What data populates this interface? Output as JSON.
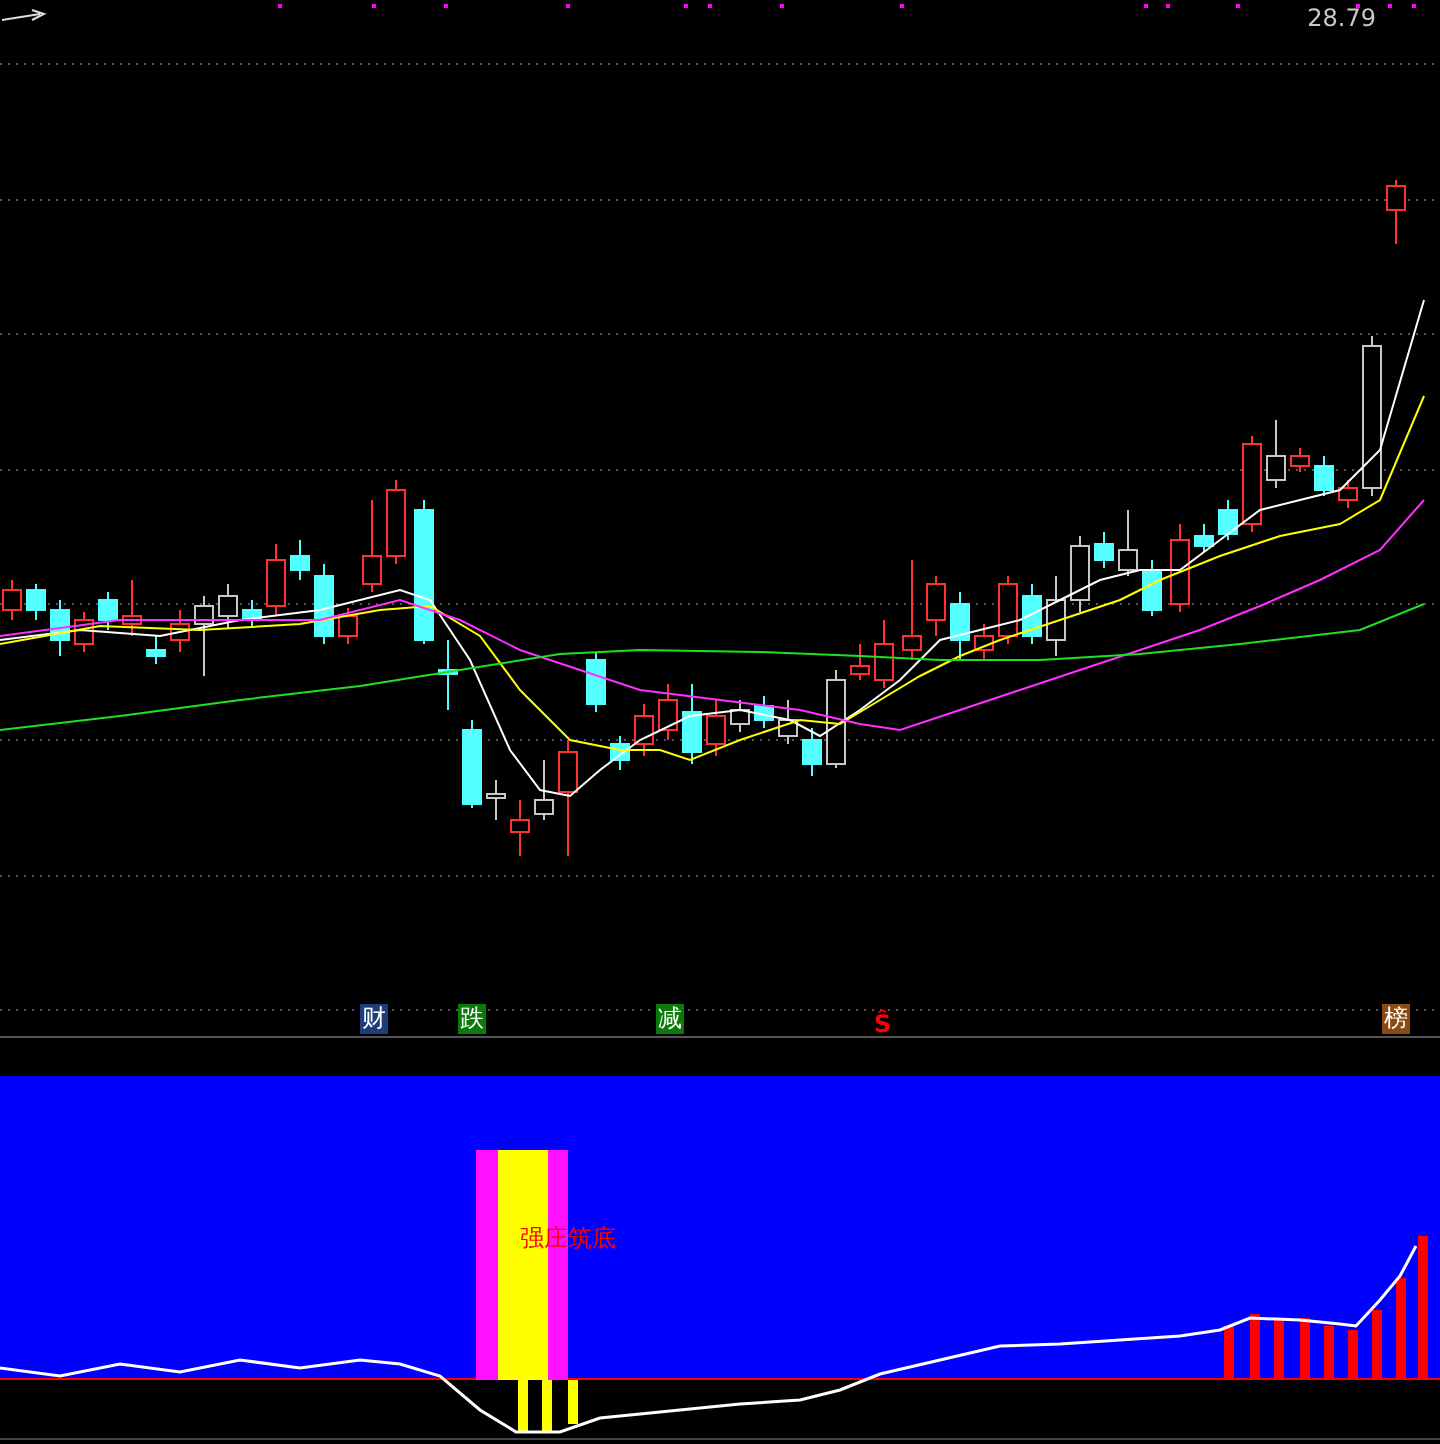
{
  "price_chart": {
    "last_price_label": "28.79",
    "event_markers": [
      {
        "label": "财",
        "kind": "badge",
        "color": "#1c3f7c"
      },
      {
        "label": "跌",
        "kind": "badge",
        "color": "#0b7a0b"
      },
      {
        "label": "减",
        "kind": "badge",
        "color": "#0b7a0b"
      },
      {
        "label": "Ŝ",
        "kind": "sign",
        "color": "#ff0000"
      },
      {
        "label": "榜",
        "kind": "badge",
        "color": "#8a4a12"
      }
    ]
  },
  "indicator_panel": {
    "signal_label": "强庄筑底"
  }
}
